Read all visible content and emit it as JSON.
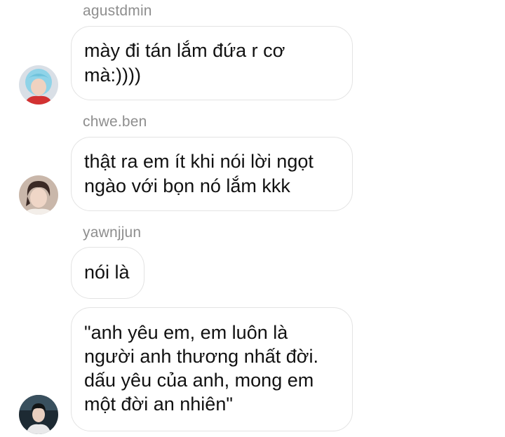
{
  "messages": [
    {
      "username": "agustdmin",
      "text": "mày đi tán lắm đứa r cơ\nmà:))))",
      "avatar": "avatar-blue-hair"
    },
    {
      "username": "chwe.ben",
      "text": "thật ra em ít khi nói lời ngọt\nngào với bọn nó lắm kkk",
      "avatar": "avatar-dark-hair"
    },
    {
      "username": "yawnjjun",
      "text": "nói là",
      "avatar": ""
    },
    {
      "username": "",
      "text": "\"anh yêu em, em luôn là\nngười anh thương nhất đời.\ndấu yêu của anh, mong em\nmột đời an nhiên\"",
      "avatar": "avatar-photo"
    }
  ],
  "colors": {
    "background": "#ffffff",
    "username": "#8e8e8e",
    "bubble_border": "#e3e3e3",
    "text": "#111111"
  }
}
